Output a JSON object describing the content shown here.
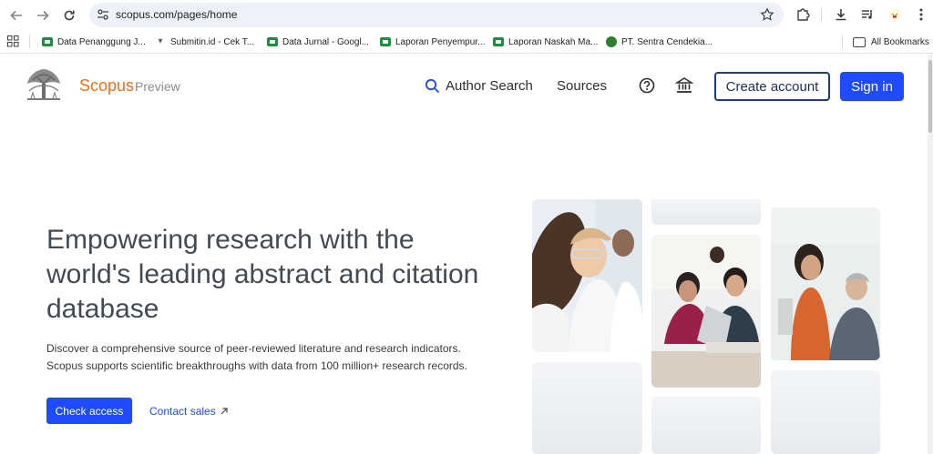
{
  "browser": {
    "url": "scopus.com/pages/home",
    "bookmarks": [
      {
        "label": "Data Penanggung J..."
      },
      {
        "label": "Submitin.id - Cek T..."
      },
      {
        "label": "Data Jurnal - Googl..."
      },
      {
        "label": "Laporan Penyempur..."
      },
      {
        "label": "Laporan Naskah Ma..."
      },
      {
        "label": "PT. Sentra Cendekia..."
      }
    ],
    "all_bookmarks": "All Bookmarks"
  },
  "header": {
    "brand": "Scopus",
    "brand_sub": "Preview",
    "author_search": "Author Search",
    "sources": "Sources",
    "create_account": "Create account",
    "sign_in": "Sign in"
  },
  "hero": {
    "headline": "Empowering research with the world's leading abstract and citation database",
    "subtext_line1": "Discover a comprehensive source of peer-reviewed literature and research indicators.",
    "subtext_line2": "Scopus supports scientific breakthroughs with data from 100 million+ research records.",
    "check_access": "Check access",
    "contact_sales": "Contact sales"
  },
  "icons": {
    "back": "arrow-left-icon",
    "forward": "arrow-right-icon",
    "reload": "reload-icon",
    "site_info": "tune-icon",
    "bookmark_star": "star-icon",
    "extensions": "puzzle-icon",
    "download": "download-icon",
    "media": "playlist-icon",
    "menu": "kebab-icon",
    "search": "search-icon",
    "help": "help-circle-icon",
    "institution": "institution-icon",
    "external": "arrow-up-right-icon"
  },
  "colors": {
    "brand_orange": "#e9711c",
    "primary_blue": "#1f4bff",
    "outline_navy": "#1e3a8a"
  }
}
